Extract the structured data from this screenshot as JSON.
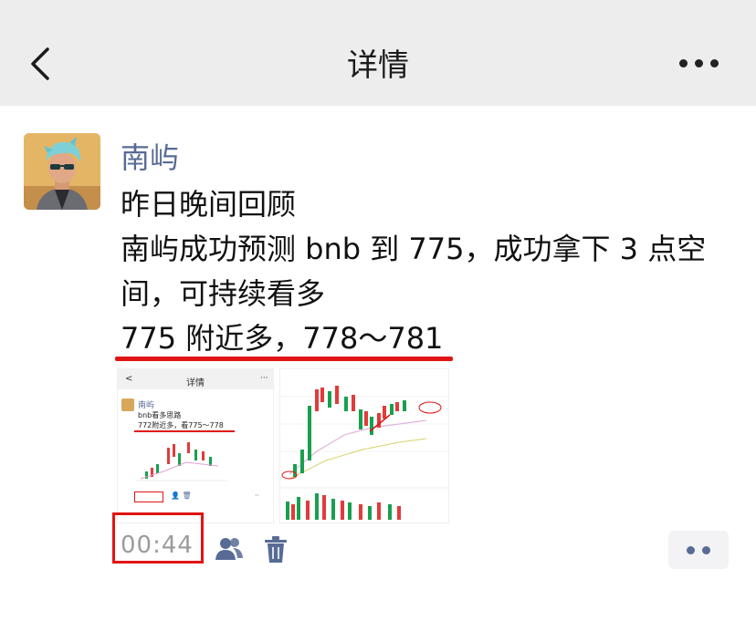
{
  "header": {
    "title": "详情"
  },
  "post": {
    "author": "南屿",
    "lines": [
      "昨日晚间回顾",
      "南屿成功预测 bnb 到 775，成功拿下 3 点空",
      "间，可持续看多",
      "775 附近多，778～781"
    ],
    "timestamp": "00:44"
  },
  "image1": {
    "title": "详情",
    "author": "南屿",
    "line1": "bnb看多思路",
    "line2": "772附近多，看775～778"
  },
  "colors": {
    "link": "#576b95",
    "highlight": "#e01515",
    "candle_up": "#e23b3b",
    "candle_down": "#18a04f"
  },
  "icons": [
    "chevron-left-icon",
    "more-icon",
    "people-icon",
    "trash-icon",
    "two-dots-icon"
  ]
}
